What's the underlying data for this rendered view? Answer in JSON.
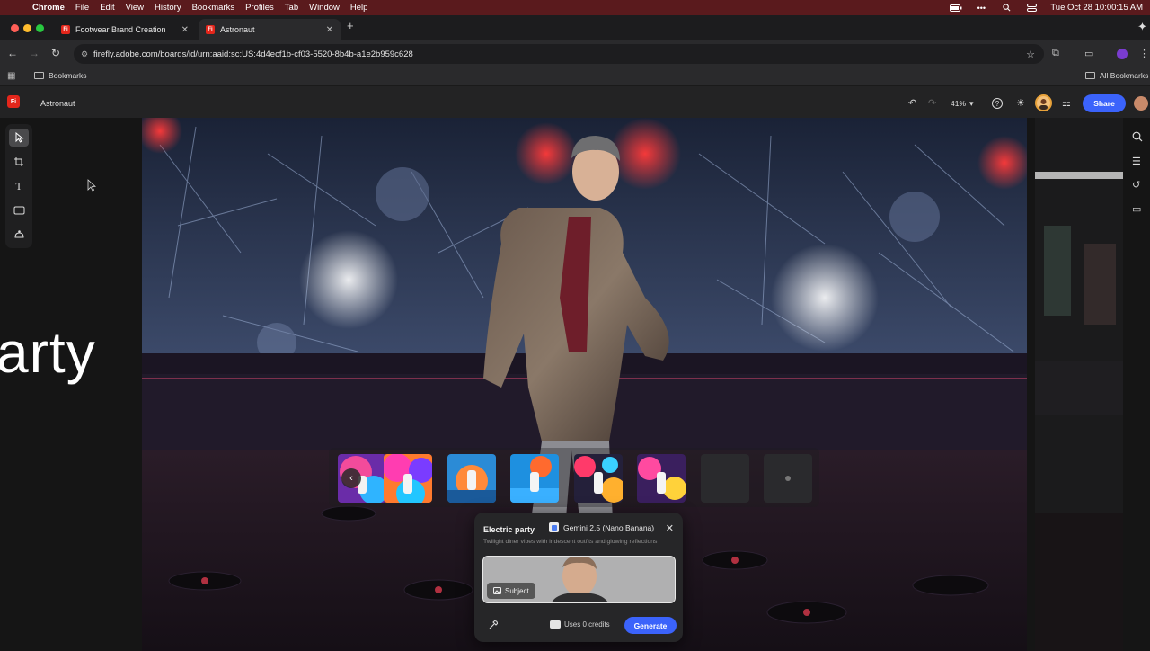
{
  "menubar": {
    "app": "Chrome",
    "items": [
      "File",
      "Edit",
      "View",
      "History",
      "Bookmarks",
      "Profiles",
      "Tab",
      "Window",
      "Help"
    ],
    "datetime": "Tue Oct 28  10:00:15 AM"
  },
  "tabs": [
    {
      "title": "Footwear Brand Creation",
      "favicon": "Fi"
    },
    {
      "title": "Astronaut",
      "favicon": "Fi"
    }
  ],
  "address": {
    "url": "firefly.adobe.com/boards/id/urn:aaid:sc:US:4d4ecf1b-cf03-5520-8b4b-a1e2b959c628"
  },
  "bookmarks": {
    "folder": "Bookmarks",
    "all": "All Bookmarks"
  },
  "app": {
    "logo": "Fi",
    "document_title": "Astronaut",
    "zoom": "41%",
    "share_label": "Share"
  },
  "canvas": {
    "side_text": "arty"
  },
  "panel": {
    "title": "Electric party",
    "model": "Gemini 2.5 (Nano Banana)",
    "description": "Twilight diner vibes with iridescent outfits and glowing reflections",
    "subject_label": "Subject",
    "credits": "Uses 0 credits",
    "generate_label": "Generate"
  },
  "colors": {
    "accent": "#3b63fb",
    "brand": "#e4261b",
    "menubar": "#5a1a1d"
  }
}
